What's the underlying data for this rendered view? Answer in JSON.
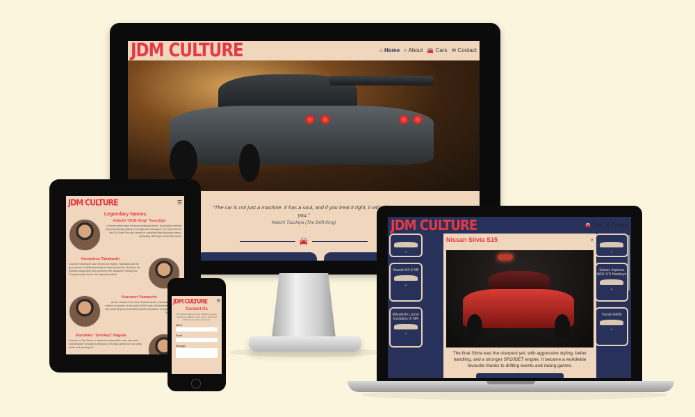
{
  "brand": "JDM CULTURE",
  "nav": {
    "home": "Home",
    "about": "About",
    "cars": "Cars",
    "contact": "Contact"
  },
  "hero": {
    "quote": "\"The car is not just a machine. It has a soul, and if you treat it right, it will talk to you.\"",
    "author": "Keiichi Tsuchiya (The Drift King)"
  },
  "legends": {
    "title": "Legendary Names",
    "people": [
      {
        "name": "Keiichi \"Drift King\" Tsuchiya",
        "bio": "A former street racer turned professional driver, Tsuchiya is credited with popularising drifting as a legitimate motorsport. He helped found the D1 Grand Prix and starred in countless Best Motoring videos, spreading JDM style across the world."
      },
      {
        "name": "Kunimitsu Takahashi",
        "bio": "A former motorcycle racer turned car legend, Takahashi laid the groundwork for drifting techniques later adopted by Tsuchiya. His fearless racing style and success in the Japanese Touring Car Championship earned him legendary status."
      },
      {
        "name": "Kazunori Yamauchi",
        "bio": "As the creator of the Gran Turismo series, Yamauchi introduced millions of gamers to the world of JDM cars. His dedication to realism and detail helped cement the cultural importance of Japanese cars in the digital era."
      },
      {
        "name": "Kazuhiko \"Smokey\" Nagata",
        "bio": "Founder of Top Secret, a Japanese automobile tuner and parts manufacturer, Smokey is famous for his high-speed runs on public roads and pushing the"
      }
    ]
  },
  "contact": {
    "title": "Contact Us",
    "intro": "We'd love to hear from you! Whether you have questions, feedback, or just want to chat about JDM cars, feel free to reach out.",
    "fields": [
      "Name",
      "Email",
      "Message"
    ]
  },
  "cars_page": {
    "cards": [
      "Mazda MX-5 NB",
      "Mitsubishi Lancer Evolution IX MR",
      "Subaru Impreza WRX STI Hawkeye",
      "Toyota GR86"
    ]
  },
  "modal": {
    "title": "Nissan Silvia S15",
    "close": "×",
    "description": "The final Silvia was the sharpest yet, with aggressive styling, better handling, and a stronger SR20DET engine. It became a worldwide favourite thanks to drifting events and racing games."
  },
  "icons": {
    "home": "home-icon",
    "search": "search-icon",
    "car": "car-icon",
    "envelope": "envelope-icon",
    "menu": "hamburger-icon"
  },
  "colors": {
    "background": "#fbf5dd",
    "cream": "#efd6bd",
    "navy": "#283159",
    "accent": "#e63946"
  }
}
